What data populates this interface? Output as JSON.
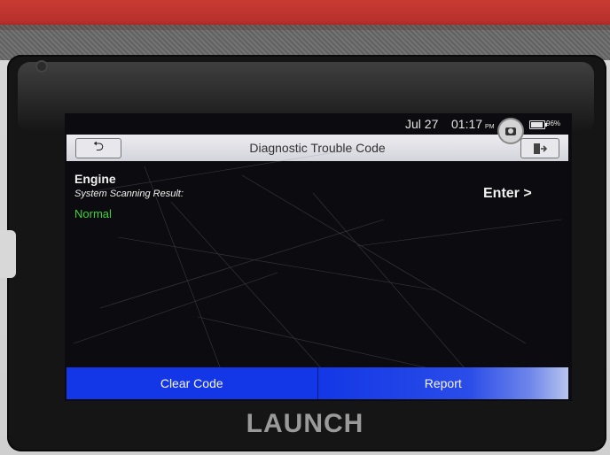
{
  "status_bar": {
    "date": "Jul 27",
    "time": "01:17",
    "ampm": "PM",
    "battery": "96%"
  },
  "header": {
    "title": "Diagnostic Trouble Code",
    "back_label": "⮌"
  },
  "result": {
    "system": "Engine",
    "subtitle": "System Scanning Result:",
    "status": "Normal",
    "enter_label": "Enter >"
  },
  "actions": {
    "clear_code": "Clear Code",
    "report": "Report"
  },
  "brand": {
    "logo": "LAUNCH"
  },
  "colors": {
    "action_bar": "#1337e6",
    "normal_status": "#3ed13e",
    "screen_bg": "#0c0c10",
    "title_bar": "#dcdce3"
  }
}
